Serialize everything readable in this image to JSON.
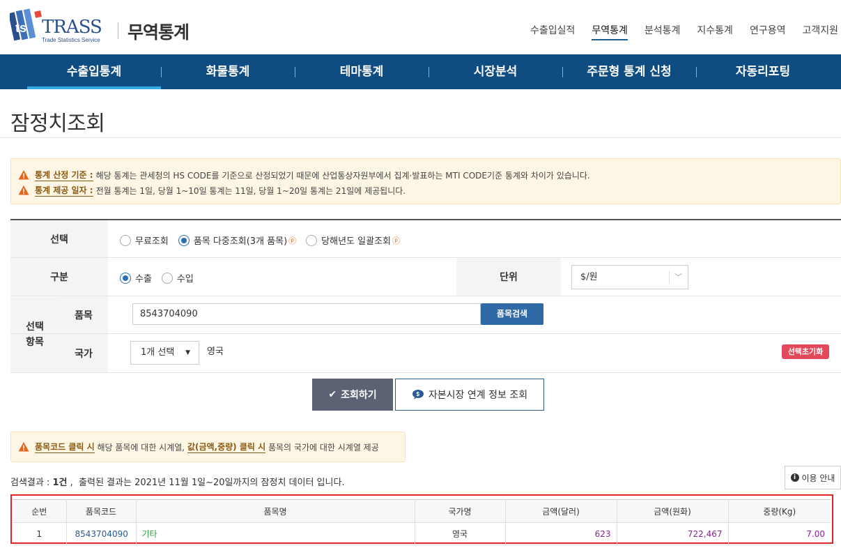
{
  "header": {
    "logo_text": "TRASS",
    "logo_sub": "Trade Statistics Service",
    "site_title": "무역통계",
    "top_nav": [
      "수출입실적",
      "무역통계",
      "분석통계",
      "지수통계",
      "연구용역",
      "고객지원"
    ],
    "top_nav_active": "무역통계"
  },
  "main_nav": {
    "items": [
      "수출입통계",
      "화물통계",
      "테마통계",
      "시장분석",
      "주문형 통계 신청",
      "자동리포팅"
    ],
    "active": "수출입통계"
  },
  "page_title": "잠정치조회",
  "notice": {
    "line1_label": "통계 산정 기준 :",
    "line1_text": "해당 통계는 관세청의 HS CODE를 기준으로 산정되었기 때문에 산업통상자원부에서 집계·발표하는 MTI CODE기준 통계와 차이가 있습니다.",
    "line2_label": "통계 제공 일자 :",
    "line2_text": "전월 통계는 1일, 당월 1~10일 통계는 11일, 당월 1~20일 통계는 21일에 제공됩니다."
  },
  "form": {
    "select_label": "선택",
    "select_options": [
      {
        "label": "무료조회",
        "checked": false,
        "premium": false
      },
      {
        "label": "품목 다중조회(3개 품목)",
        "checked": true,
        "premium": true
      },
      {
        "label": "당해년도 일괄조회",
        "checked": false,
        "premium": true
      }
    ],
    "premium_mark": "ⓟ",
    "type_label": "구분",
    "type_options": [
      {
        "label": "수출",
        "checked": true
      },
      {
        "label": "수입",
        "checked": false
      }
    ],
    "unit_label": "단위",
    "unit_value": "$/원",
    "items_label_line1": "선택",
    "items_label_line2": "항목",
    "item_label": "품목",
    "item_code": "8543704090",
    "item_search_button": "품목검색",
    "country_label": "국가",
    "country_dropdown": "1개 선택",
    "country_selected": "영국",
    "reset_button": "선택초기화"
  },
  "actions": {
    "query_button": "조회하기",
    "capital_button": "자본시장 연계 정보 조회"
  },
  "notice2": {
    "part1_bold": "품목코드 클릭 시",
    "part2": " 해당 품목에 대한 시계열, ",
    "part3_bold": "값(금액,중량) 클릭 시",
    "part4": " 품목의 국가에 대한 시계열 제공"
  },
  "result_summary": {
    "prefix": "검색결과 : ",
    "count": "1건",
    "suffix": " ,  출력된 결과는 2021년 11월 1일~20일까지의 잠정치 데이터 입니다."
  },
  "help_button": "이용 안내",
  "table": {
    "headers": [
      "순번",
      "품목코드",
      "품목명",
      "국가명",
      "금액(달러)",
      "금액(원화)",
      "중량(Kg)"
    ],
    "rows": [
      {
        "no": "1",
        "code": "8543704090",
        "name": "기타",
        "country": "영국",
        "usd": "623",
        "krw": "722,467",
        "weight": "7.00"
      }
    ]
  },
  "colors": {
    "nav_bg": "#0f4c81",
    "nav_active_bar": "#34a9e0",
    "highlight_box": "#e2232a",
    "primary_button": "#2f6aa6",
    "reset_button": "#e3495b",
    "value_text": "#8a2493",
    "name_text": "#2e9c3f"
  }
}
